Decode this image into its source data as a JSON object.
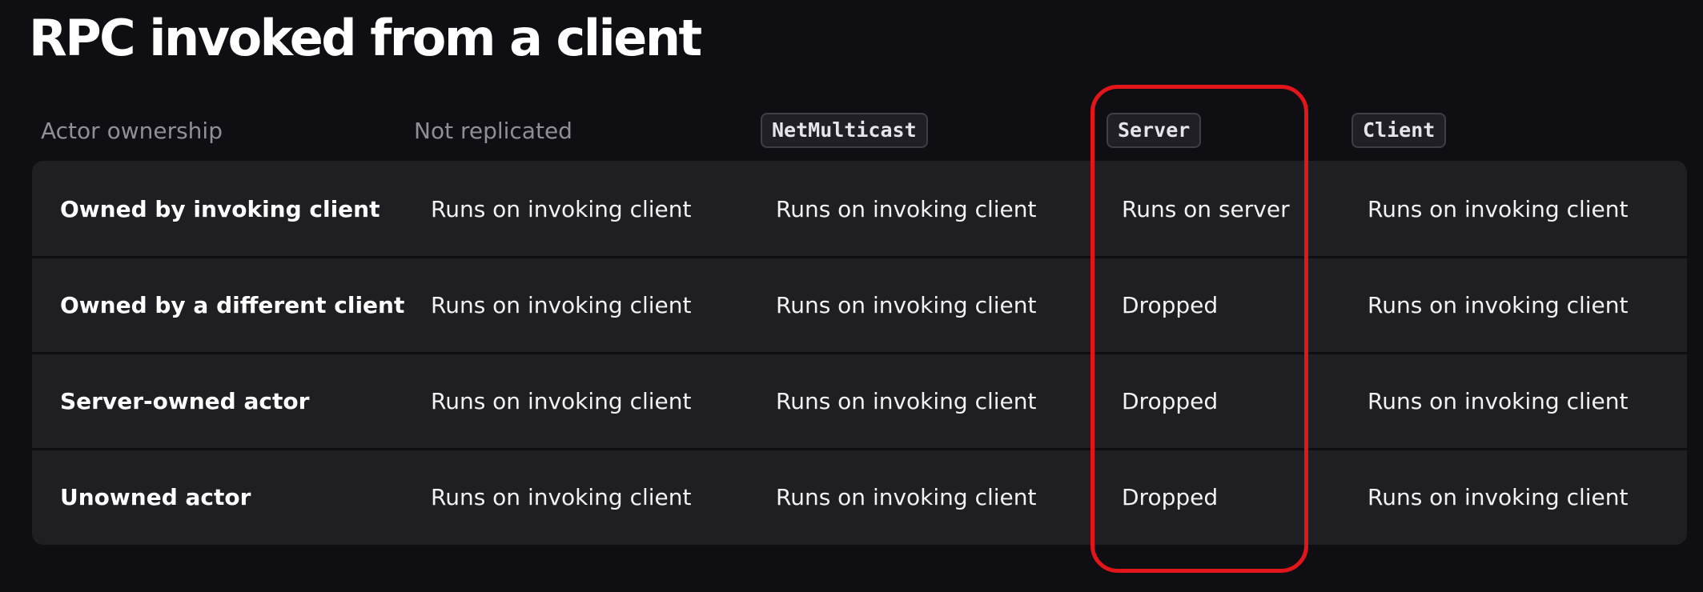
{
  "page": {
    "title": "RPC invoked from a client",
    "highlight_color": "#e3141a"
  },
  "table": {
    "headers": [
      {
        "label": "Actor ownership",
        "style": "text"
      },
      {
        "label": "Not replicated",
        "style": "text"
      },
      {
        "label": "NetMulticast",
        "style": "code"
      },
      {
        "label": "Server",
        "style": "code"
      },
      {
        "label": "Client",
        "style": "code"
      }
    ],
    "rows": [
      {
        "label": "Owned by invoking client",
        "cells": [
          "Runs on invoking client",
          "Runs on invoking client",
          "Runs on server",
          "Runs on invoking client"
        ]
      },
      {
        "label": "Owned by a different client",
        "cells": [
          "Runs on invoking client",
          "Runs on invoking client",
          "Dropped",
          "Runs on invoking client"
        ]
      },
      {
        "label": "Server-owned actor",
        "cells": [
          "Runs on invoking client",
          "Runs on invoking client",
          "Dropped",
          "Runs on invoking client"
        ]
      },
      {
        "label": "Unowned actor",
        "cells": [
          "Runs on invoking client",
          "Runs on invoking client",
          "Dropped",
          "Runs on invoking client"
        ]
      }
    ]
  }
}
